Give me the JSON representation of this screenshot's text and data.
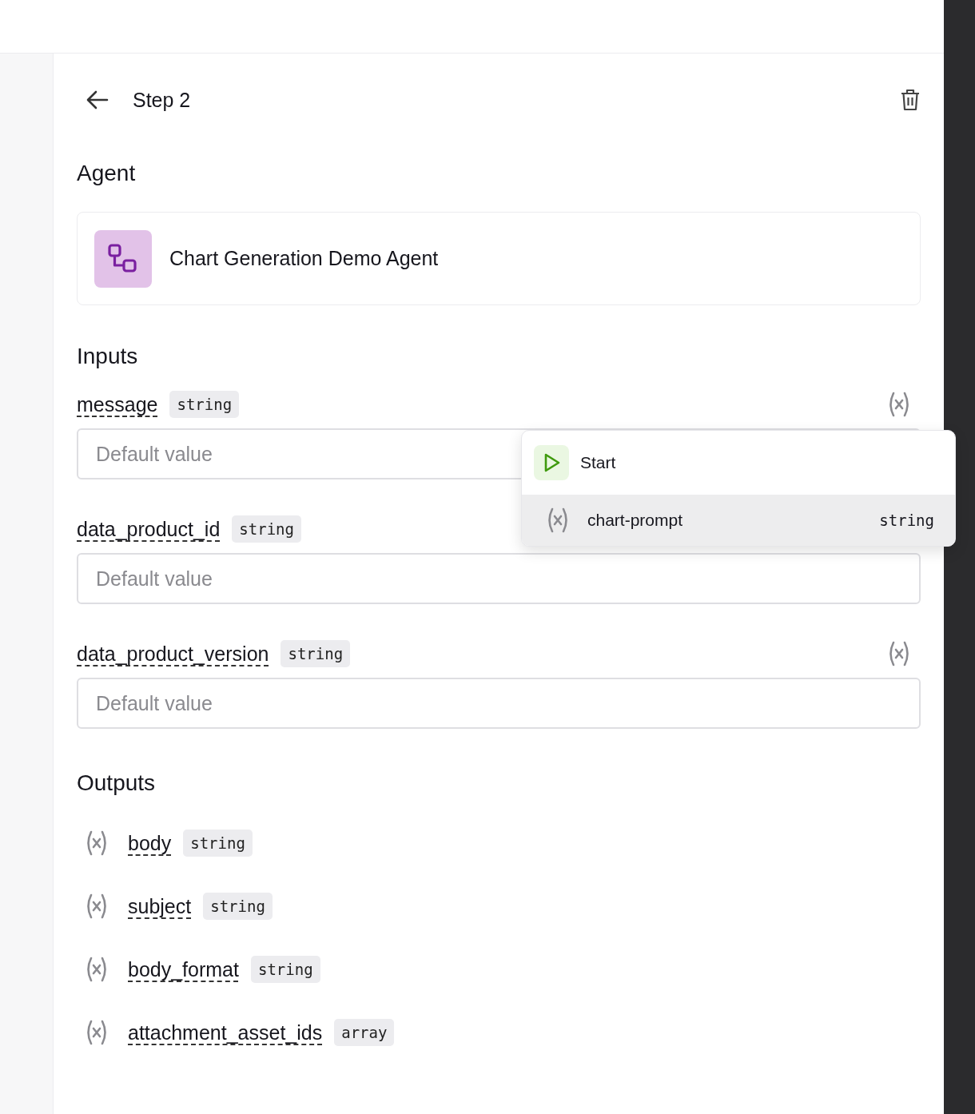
{
  "header": {
    "title": "Step 2"
  },
  "agent": {
    "heading": "Agent",
    "name": "Chart Generation Demo Agent"
  },
  "inputs": {
    "heading": "Inputs",
    "items": [
      {
        "name": "message",
        "type": "string",
        "placeholder": "Default value"
      },
      {
        "name": "data_product_id",
        "type": "string",
        "placeholder": "Default value"
      },
      {
        "name": "data_product_version",
        "type": "string",
        "placeholder": "Default value"
      }
    ]
  },
  "outputs": {
    "heading": "Outputs",
    "items": [
      {
        "name": "body",
        "type": "string"
      },
      {
        "name": "subject",
        "type": "string"
      },
      {
        "name": "body_format",
        "type": "string"
      },
      {
        "name": "attachment_asset_ids",
        "type": "array"
      }
    ]
  },
  "variable_menu": {
    "items": [
      {
        "kind": "source",
        "label": "Start",
        "selected": false
      },
      {
        "kind": "variable",
        "label": "chart-prompt",
        "type": "string",
        "selected": true
      }
    ]
  }
}
